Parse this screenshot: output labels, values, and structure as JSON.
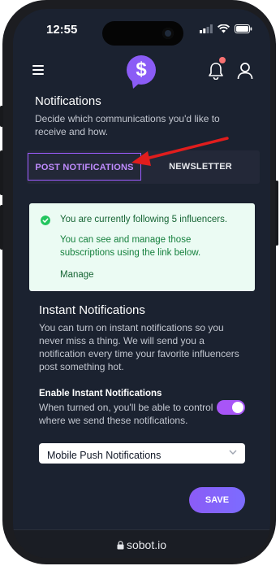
{
  "status_bar": {
    "time": "12:55"
  },
  "header": {
    "logo_symbol": "$"
  },
  "page": {
    "title": "Notifications",
    "subtitle": "Decide which communications you'd like to receive and how."
  },
  "tabs": [
    {
      "label": "POST NOTIFICATIONS",
      "active": true
    },
    {
      "label": "NEWSLETTER",
      "active": false
    }
  ],
  "alert": {
    "title": "You are currently following 5 influencers.",
    "body": "You can see and manage those subscriptions using the link below.",
    "link": "Manage"
  },
  "instant": {
    "title": "Instant Notifications",
    "description": "You can turn on instant notifications so you never miss a thing. We will send you a notification every time your favorite influencers post something hot.",
    "enable_label": "Enable Instant Notifications",
    "enable_help": "When turned on, you'll be able to control where we send these notifications.",
    "toggle_on": true,
    "select_value": "Mobile Push Notifications"
  },
  "actions": {
    "save_label": "SAVE"
  },
  "browser": {
    "url": "sobot.io"
  },
  "colors": {
    "accent": "#8b5cf6",
    "screen_bg": "#1b2230",
    "alert_bg": "#ebfbf3",
    "alert_icon": "#22c55e",
    "annotation_arrow": "#e11d1d"
  }
}
